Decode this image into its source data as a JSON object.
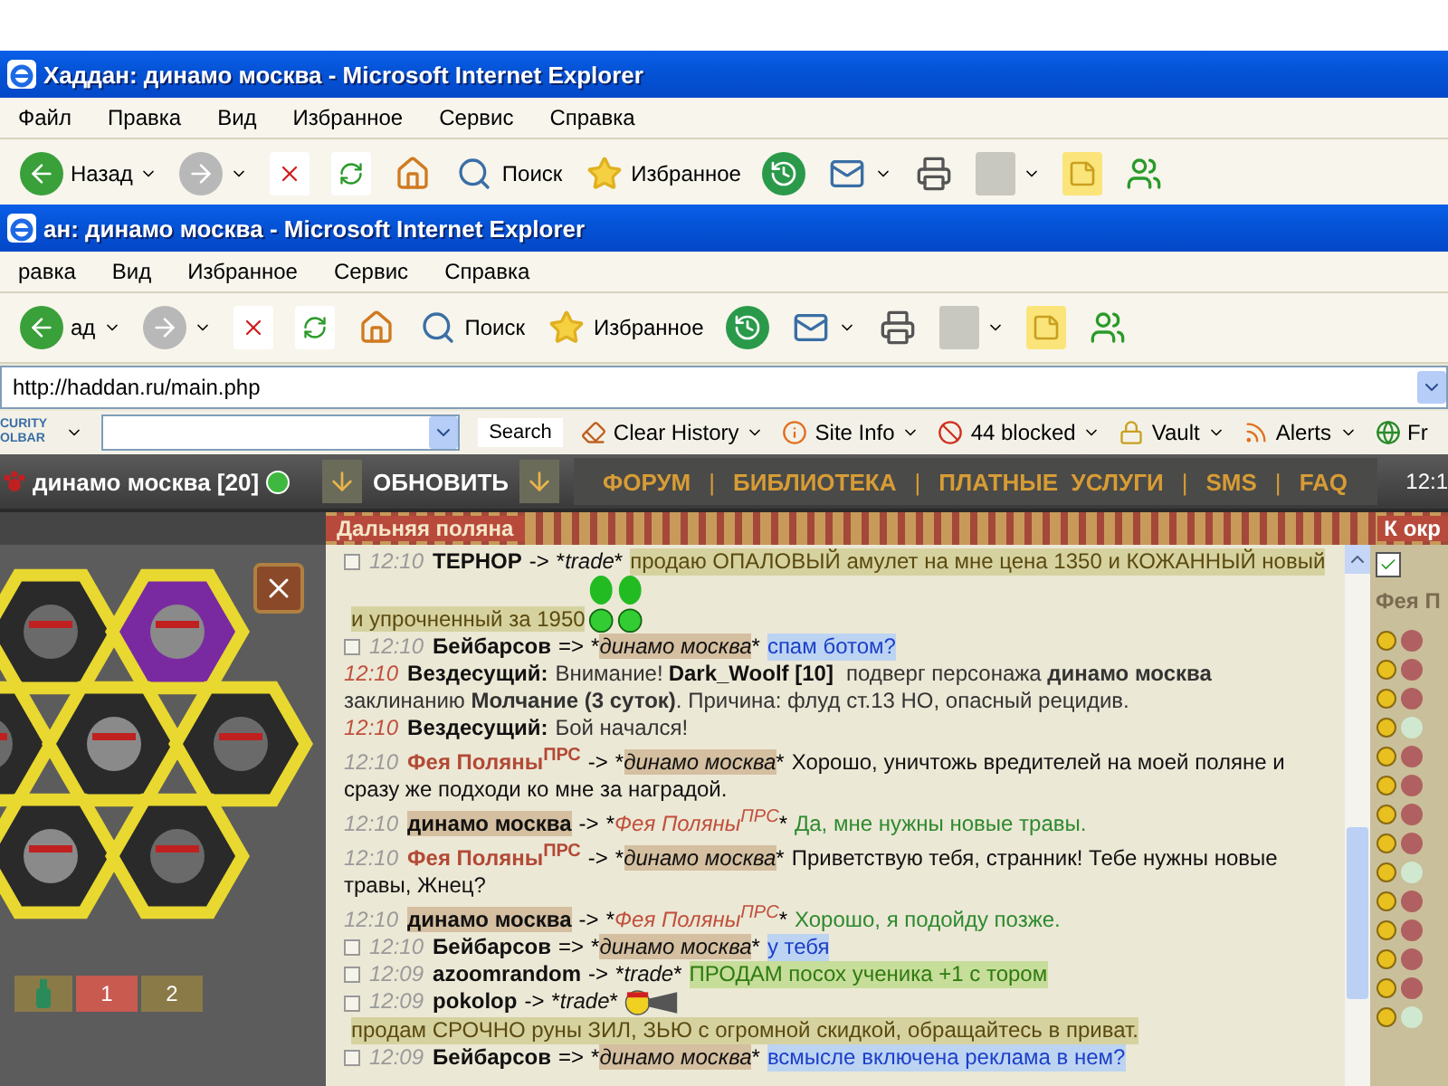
{
  "back_window": {
    "title": "Хаддан: динамо москва - Microsoft Internet Explorer",
    "menu": [
      "Файл",
      "Правка",
      "Вид",
      "Избранное",
      "Сервис",
      "Справка"
    ],
    "toolbar": [
      {
        "kind": "back",
        "label": "Назад"
      },
      {
        "kind": "forward"
      },
      {
        "kind": "stop"
      },
      {
        "kind": "refresh"
      },
      {
        "kind": "home"
      },
      {
        "kind": "search",
        "label": "Поиск"
      },
      {
        "kind": "favorites",
        "label": "Избранное"
      },
      {
        "kind": "history"
      },
      {
        "kind": "mail"
      },
      {
        "kind": "print"
      },
      {
        "kind": "edit"
      },
      {
        "kind": "note"
      },
      {
        "kind": "messenger"
      }
    ]
  },
  "front_window": {
    "title": "ан: динамо москва - Microsoft Internet Explorer",
    "menu": [
      "равка",
      "Вид",
      "Избранное",
      "Сервис",
      "Справка"
    ],
    "toolbar": [
      {
        "kind": "back",
        "label": "ад"
      },
      {
        "kind": "forward"
      },
      {
        "kind": "stop"
      },
      {
        "kind": "refresh"
      },
      {
        "kind": "home"
      },
      {
        "kind": "search",
        "label": "Поиск"
      },
      {
        "kind": "favorites",
        "label": "Избранное"
      },
      {
        "kind": "history"
      },
      {
        "kind": "mail"
      },
      {
        "kind": "print"
      },
      {
        "kind": "edit"
      },
      {
        "kind": "note"
      },
      {
        "kind": "messenger"
      }
    ],
    "address": "http://haddan.ru/main.php",
    "security_toolbar": {
      "logo": [
        "CURITY",
        "OLBAR"
      ],
      "search_button": "Search",
      "items": [
        {
          "kind": "clear",
          "label": "Clear History"
        },
        {
          "kind": "info",
          "label": "Site Info"
        },
        {
          "kind": "blocked",
          "label": "44 blocked"
        },
        {
          "kind": "vault",
          "label": "Vault"
        },
        {
          "kind": "alerts",
          "label": "Alerts"
        },
        {
          "kind": "globe",
          "label": "Fr"
        }
      ]
    }
  },
  "game": {
    "player": "динамо москва [20]",
    "refresh": "ОБНОВИТЬ",
    "nav": [
      "ФОРУМ",
      "БИБЛИОТЕКА",
      "ПЛАТНЫЕ  УСЛУГИ",
      "SMS",
      "FAQ"
    ],
    "nav_sep": [
      "|",
      "|",
      "|",
      "|"
    ],
    "clock": "12:1",
    "location": "Дальняя поляна",
    "location_right": "К окр",
    "belt": [
      {
        "label": "1",
        "selected": true
      },
      {
        "label": "2",
        "selected": false
      }
    ],
    "chat": [
      {
        "kind": "player",
        "checked": false,
        "time": "12:10",
        "from": {
          "kind": "player",
          "name": "ТЕРНОР"
        },
        "op": "->",
        "to_pre": "*",
        "to": {
          "kind": "channel",
          "name": "trade"
        },
        "to_post": "*",
        "body": {
          "kind": "olive",
          "text": "продаю ОПАЛОВЫЙ амулет на мне цена 1350 и КОЖАННЫЙ новый"
        },
        "emote": true,
        "text_after": "и упрочненный за 1950"
      },
      {
        "kind": "player",
        "checked": false,
        "time": "12:10",
        "from": {
          "kind": "player",
          "name": "Бейбарсов"
        },
        "op": "=>",
        "to_pre": "*",
        "to": {
          "kind": "self",
          "name": "динамо москва"
        },
        "to_post": "*",
        "body": {
          "kind": "blue",
          "text": "спам ботом?"
        }
      },
      {
        "kind": "system",
        "time": "12:10",
        "from": "Вездесущий:",
        "text": "Внимание!",
        "actor": "Dark_Woolf [10]",
        "text_after": "подверг персонажа **динамо москва** заклинанию **Молчание (3 суток)**. Причина: флуд ст.13 НО, опасный рецидив."
      },
      {
        "kind": "system",
        "time": "12:10",
        "from": "Вездесущий:",
        "text": "Бой начался!"
      },
      {
        "kind": "quest",
        "time": "12:10",
        "from": {
          "kind": "npc",
          "name": "Фея Поляны$^{ПРС}$"
        },
        "op": "->",
        "to_pre": "*",
        "to": {
          "kind": "self",
          "name": "динамо москва"
        },
        "to_post": "*",
        "body": {
          "kind": "plain",
          "text": "Хорошо, уничтожь вредителей на моей поляне и сразу же подходи ко мне за наградой."
        }
      },
      {
        "kind": "quest",
        "time": "12:10",
        "from": {
          "kind": "self",
          "name": "динамо москва"
        },
        "op": "->",
        "to_pre": "*",
        "to": {
          "kind": "npc",
          "name": "Фея Поляны$^{ПРС}$"
        },
        "to_post": "*",
        "body": {
          "kind": "green",
          "text": "Да, мне нужны новые травы."
        }
      },
      {
        "kind": "quest",
        "time": "12:10",
        "from": {
          "kind": "npc",
          "name": "Фея Поляны$^{ПРС}$"
        },
        "op": "->",
        "to_pre": "*",
        "to": {
          "kind": "self",
          "name": "динамо москва"
        },
        "to_post": "*",
        "body": {
          "kind": "plain",
          "text": "Приветствую тебя, странник! Тебе нужны новые травы, Жнец?"
        }
      },
      {
        "kind": "quest",
        "time": "12:10",
        "from": {
          "kind": "self",
          "name": "динамо москва"
        },
        "op": "->",
        "to_pre": "*",
        "to": {
          "kind": "npc",
          "name": "Фея Поляны$^{ПРС}$"
        },
        "to_post": "*",
        "body": {
          "kind": "green",
          "text": "Хорошо, я подойду позже."
        }
      },
      {
        "kind": "player",
        "checked": false,
        "time": "12:10",
        "from": {
          "kind": "player",
          "name": "Бейбарсов"
        },
        "op": "=>",
        "to_pre": "*",
        "to": {
          "kind": "self",
          "name": "динамо москва"
        },
        "to_post": "*",
        "body": {
          "kind": "blue",
          "text": "у тебя"
        }
      },
      {
        "kind": "player",
        "checked": false,
        "time": "12:09",
        "from": {
          "kind": "player",
          "name": "azoomrandom"
        },
        "op": "->",
        "to_pre": "*",
        "to": {
          "kind": "channel",
          "name": "trade"
        },
        "to_post": "*",
        "body": {
          "kind": "greenbg",
          "text": "ПРОДАМ посох ученика +1 с тором"
        }
      },
      {
        "kind": "player",
        "checked": false,
        "time": "12:09",
        "from": {
          "kind": "player",
          "name": "pokolop"
        },
        "op": "->",
        "to_pre": "*",
        "to": {
          "kind": "channel",
          "name": "trade"
        },
        "to_post": "*",
        "body": {
          "kind": "olive",
          "text": "продам СРОЧНО руны ЗИЛ, ЗЬЮ с огромной скидкой, обращайтесь в приват."
        },
        "banner": true
      },
      {
        "kind": "player",
        "checked": false,
        "time": "12:09",
        "from": {
          "kind": "player",
          "name": "Бейбарсов"
        },
        "op": "=>",
        "to_pre": "*",
        "to": {
          "kind": "self",
          "name": "динамо москва"
        },
        "to_post": "*",
        "body": {
          "kind": "blue",
          "text": "всмысле включена реклама в нем?"
        }
      }
    ],
    "side_panel": {
      "checked": true,
      "title": "Фея П"
    }
  }
}
